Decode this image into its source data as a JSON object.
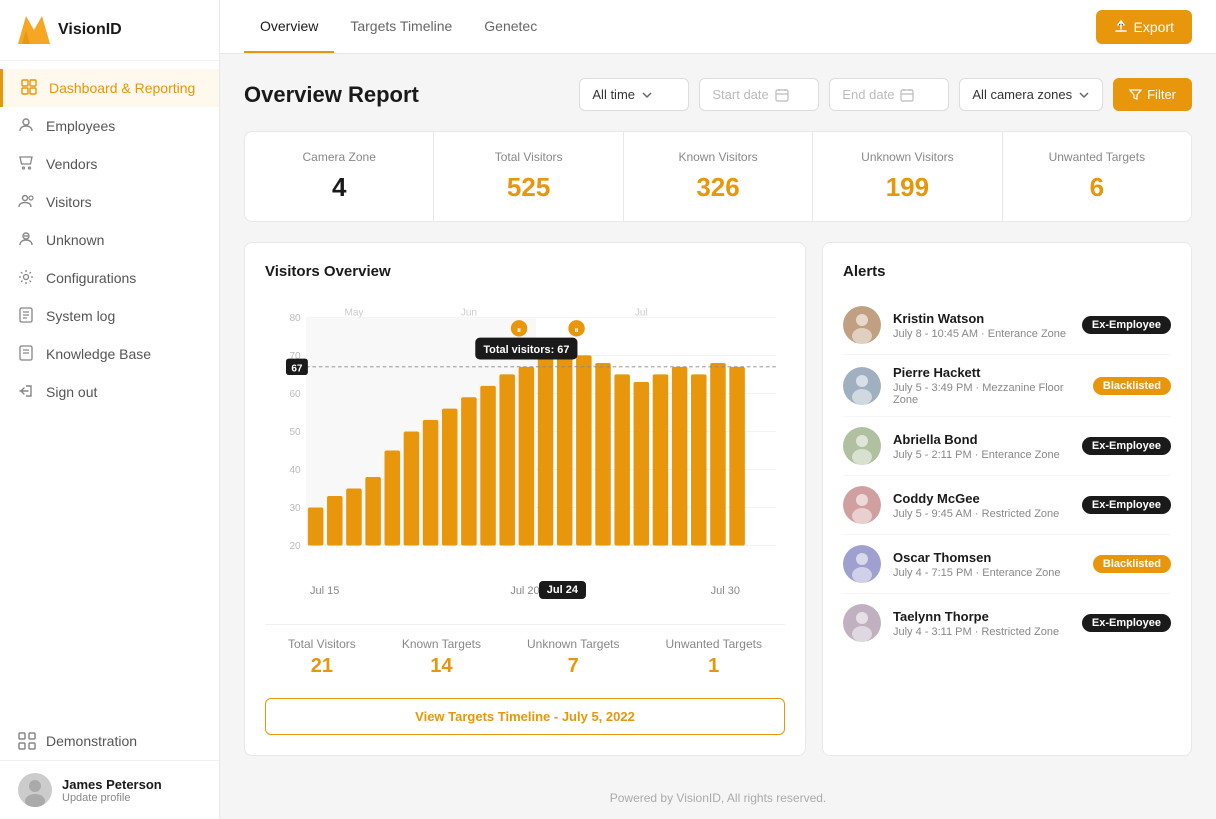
{
  "app": {
    "name": "VisionID"
  },
  "sidebar": {
    "nav_items": [
      {
        "id": "dashboard",
        "label": "Dashboard & Reporting",
        "active": true
      },
      {
        "id": "employees",
        "label": "Employees",
        "active": false
      },
      {
        "id": "vendors",
        "label": "Vendors",
        "active": false
      },
      {
        "id": "visitors",
        "label": "Visitors",
        "active": false
      },
      {
        "id": "unknown",
        "label": "Unknown",
        "active": false
      },
      {
        "id": "configurations",
        "label": "Configurations",
        "active": false
      },
      {
        "id": "system-log",
        "label": "System log",
        "active": false
      },
      {
        "id": "knowledge-base",
        "label": "Knowledge Base",
        "active": false
      },
      {
        "id": "sign-out",
        "label": "Sign out",
        "active": false
      }
    ],
    "demo_label": "Demonstration",
    "user": {
      "name": "James Peterson",
      "sub": "Update profile"
    }
  },
  "top_nav": {
    "tabs": [
      {
        "id": "overview",
        "label": "Overview",
        "active": true
      },
      {
        "id": "targets-timeline",
        "label": "Targets Timeline",
        "active": false
      },
      {
        "id": "genetec",
        "label": "Genetec",
        "active": false
      }
    ],
    "export_label": "Export"
  },
  "report": {
    "title": "Overview Report",
    "filter_time": "All time",
    "start_date_placeholder": "Start date",
    "end_date_placeholder": "End date",
    "camera_zones": "All camera zones",
    "filter_label": "Filter",
    "stats": [
      {
        "label": "Camera Zone",
        "value": "4",
        "color": "dark"
      },
      {
        "label": "Total Visitors",
        "value": "525",
        "color": "orange"
      },
      {
        "label": "Known Visitors",
        "value": "326",
        "color": "orange"
      },
      {
        "label": "Unknown Visitors",
        "value": "199",
        "color": "orange"
      },
      {
        "label": "Unwanted Targets",
        "value": "6",
        "color": "orange"
      }
    ]
  },
  "chart": {
    "title": "Visitors Overview",
    "tooltip": "Total visitors: 67",
    "tooltip_date": "Jul 24",
    "y_labels": [
      "80",
      "70",
      "60",
      "50",
      "40",
      "30",
      "20"
    ],
    "x_labels": [
      "Jul 15",
      "Jul 20",
      "Jul 24",
      "Jul 30"
    ],
    "month_labels": [
      "May",
      "Jun",
      "Jul"
    ],
    "bar_values": [
      30,
      33,
      35,
      38,
      45,
      50,
      53,
      56,
      59,
      62,
      65,
      67,
      70,
      72,
      70,
      68,
      65,
      63,
      65,
      67,
      65,
      68,
      67
    ],
    "stats": [
      {
        "label": "Total Visitors",
        "value": "21"
      },
      {
        "label": "Known Targets",
        "value": "14"
      },
      {
        "label": "Unknown Targets",
        "value": "7"
      },
      {
        "label": "Unwanted Targets",
        "value": "1"
      }
    ],
    "view_timeline_label": "View Targets Timeline - July 5, 2022"
  },
  "alerts": {
    "title": "Alerts",
    "items": [
      {
        "name": "Kristin Watson",
        "detail": "July 8 - 10:45 AM · Enterance Zone",
        "badge": "Ex-Employee",
        "badge_type": "ex"
      },
      {
        "name": "Pierre Hackett",
        "detail": "July 5 - 3:49 PM · Mezzanine Floor Zone",
        "badge": "Blacklisted",
        "badge_type": "blacklist"
      },
      {
        "name": "Abriella Bond",
        "detail": "July 5 - 2:11 PM · Enterance Zone",
        "badge": "Ex-Employee",
        "badge_type": "ex"
      },
      {
        "name": "Coddy McGee",
        "detail": "July 5 - 9:45 AM · Restricted Zone",
        "badge": "Ex-Employee",
        "badge_type": "ex"
      },
      {
        "name": "Oscar Thomsen",
        "detail": "July 4 - 7:15 PM · Enterance Zone",
        "badge": "Blacklisted",
        "badge_type": "blacklist"
      },
      {
        "name": "Taelynn Thorpe",
        "detail": "July 4 - 3:11 PM · Restricted Zone",
        "badge": "Ex-Employee",
        "badge_type": "ex"
      }
    ]
  },
  "footer": {
    "text": "Powered by VisionID, All rights reserved."
  }
}
